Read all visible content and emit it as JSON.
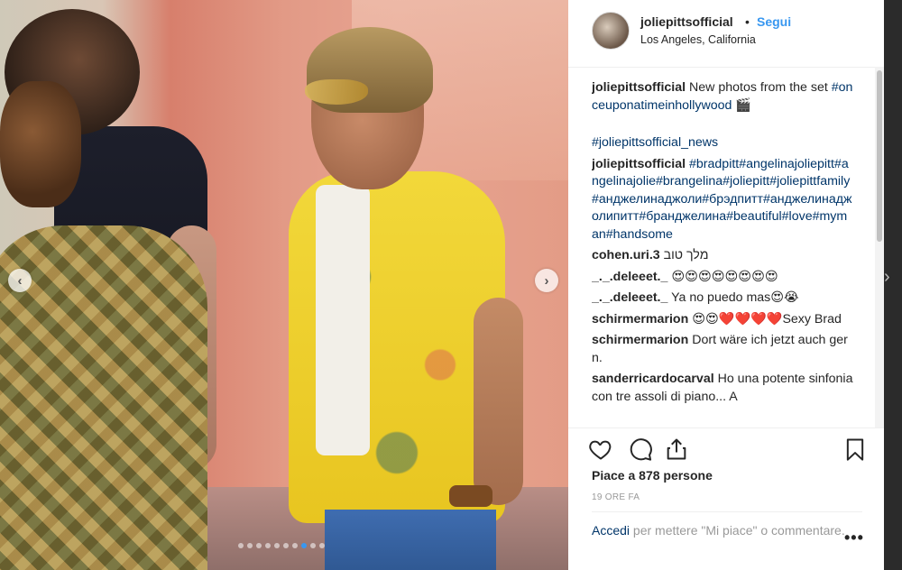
{
  "post": {
    "username": "joliepittsofficial",
    "dot": "•",
    "follow_label": "Segui",
    "location": "Los Angeles, California"
  },
  "photo": {
    "slide_count": 10,
    "active_slide": 8
  },
  "caption": {
    "username": "joliepittsofficial",
    "text": "New photos from the set",
    "hashtag": "#onceuponatimeinhollywood",
    "emoji": "🎬",
    "hashtag2": "#joliepittsofficial_news"
  },
  "tags_comment": {
    "username": "joliepittsofficial",
    "text": "#bradpitt#angelinajoliepitt#angelinajolie#brangelina#joliepitt#joliepittfamily#анджелинаджоли#брэдпитт#анджелинаджолипитт#бранджелина#beautiful#love#myman#handsome"
  },
  "comments": [
    {
      "username": "cohen.uri.3",
      "text": "מלך טוב"
    },
    {
      "username": "_._.deleeet._",
      "text": "😍😍😍😍😍😍😍😍"
    },
    {
      "username": "_._.deleeet._",
      "text": "Ya no puedo mas😍😭"
    },
    {
      "username": "schirmermarion",
      "text": "😍😍❤️❤️❤️❤️Sexy Brad"
    },
    {
      "username": "schirmermarion",
      "text": "Dort wäre ich jetzt auch gern."
    },
    {
      "username": "sanderricardocarval",
      "text": "Ho una potente sinfonia con tre assoli di piano... A"
    }
  ],
  "likes_text": "Piace a 878 persone",
  "time_ago": "19 ORE FA",
  "comment_bar": {
    "login": "Accedi",
    "rest": "per mettere \"Mi piace\" o commentare.",
    "more": "•••"
  },
  "icons": {
    "like": "heart-icon",
    "comment": "speech-bubble-icon",
    "share": "share-icon",
    "save": "bookmark-icon",
    "prev": "chevron-left-icon",
    "next": "chevron-right-icon"
  },
  "colors": {
    "link_blue": "#3897f0",
    "hashtag_navy": "#003569",
    "text": "#262626",
    "muted": "#999999"
  },
  "carousel": {
    "prev": "‹",
    "next": "›"
  }
}
